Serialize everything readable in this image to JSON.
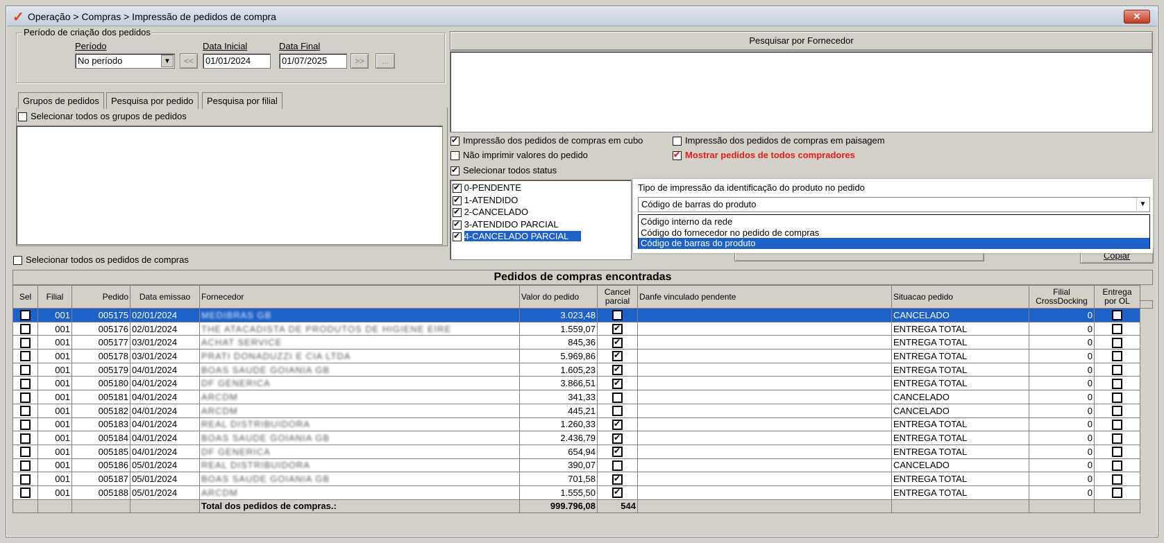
{
  "window": {
    "title": "Operação > Compras > Impressão de pedidos de compra",
    "close": "✕"
  },
  "periodo_group": {
    "legend": "Período de criação dos pedidos",
    "periodo_label": "Período",
    "periodo_value": "No período",
    "data_inicial_label": "Data Inicial",
    "data_inicial_value": "01/01/2024",
    "data_final_label": "Data Final",
    "data_final_value": "01/07/2025",
    "prev_btn": "<<",
    "next_btn": ">>",
    "more_btn": "..."
  },
  "tabs": [
    "Grupos de pedidos",
    "Pesquisa por pedido",
    "Pesquisa por filial"
  ],
  "select_all_groups": "Selecionar todos os grupos de pedidos",
  "select_all_orders": "Selecionar todos os pedidos de compras",
  "fornecedor_header": "Pesquisar por Fornecedor",
  "options": {
    "cubo": "Impressão dos pedidos de compras em cubo",
    "paisagem": "Impressão dos pedidos de compras em paisagem",
    "nao_imprimir": "Não imprimir valores do pedido",
    "mostrar_todos": "Mostrar pedidos de todos compradores",
    "selecionar_status": "Selecionar todos status"
  },
  "status_list": [
    "0-PENDENTE",
    "1-ATENDIDO",
    "2-CANCELADO",
    "3-ATENDIDO PARCIAL",
    "4-CANCELADO PARCIAL"
  ],
  "tipo_impressao": {
    "label": "Tipo de impressão da identificação do produto no pedido",
    "value": "Código de barras do produto",
    "options": [
      "Código interno da rede",
      "Código do fornecedor no pedido de compras",
      "Código de barras do produto"
    ]
  },
  "copiar_btn": "Copiar",
  "grid": {
    "title": "Pedidos de compras encontradas",
    "headers": {
      "sel": "Sel",
      "filial": "Filial",
      "pedido": "Pedido",
      "data": "Data emissao",
      "fornecedor": "Fornecedor",
      "valor": "Valor do pedido",
      "cancel": "Cancel parcial",
      "danfe": "Danfe vinculado pendente",
      "situacao": "Situacao pedido",
      "crossdock": "Filial CrossDocking",
      "entrega": "Entrega por OL"
    },
    "rows": [
      {
        "filial": "001",
        "pedido": "005175",
        "data": "02/01/2024",
        "fornecedor": "MEDIBRAS GB",
        "valor": "3.023,48",
        "cancel": false,
        "situacao": "CANCELADO",
        "cross": "0"
      },
      {
        "filial": "001",
        "pedido": "005176",
        "data": "02/01/2024",
        "fornecedor": "THE ATACADISTA DE PRODUTOS DE HIGIENE EIRE",
        "valor": "1.559,07",
        "cancel": true,
        "situacao": "ENTREGA TOTAL",
        "cross": "0"
      },
      {
        "filial": "001",
        "pedido": "005177",
        "data": "03/01/2024",
        "fornecedor": "ACHAT SERVICE",
        "valor": "845,36",
        "cancel": true,
        "situacao": "ENTREGA TOTAL",
        "cross": "0"
      },
      {
        "filial": "001",
        "pedido": "005178",
        "data": "03/01/2024",
        "fornecedor": "PRATI DONADUZZI E CIA LTDA",
        "valor": "5.969,86",
        "cancel": true,
        "situacao": "ENTREGA TOTAL",
        "cross": "0"
      },
      {
        "filial": "001",
        "pedido": "005179",
        "data": "04/01/2024",
        "fornecedor": "BOAS SAUDE GOIANIA GB",
        "valor": "1.605,23",
        "cancel": true,
        "situacao": "ENTREGA TOTAL",
        "cross": "0"
      },
      {
        "filial": "001",
        "pedido": "005180",
        "data": "04/01/2024",
        "fornecedor": "DF GENERICA",
        "valor": "3.866,51",
        "cancel": true,
        "situacao": "ENTREGA TOTAL",
        "cross": "0"
      },
      {
        "filial": "001",
        "pedido": "005181",
        "data": "04/01/2024",
        "fornecedor": "ARCDM",
        "valor": "341,33",
        "cancel": false,
        "situacao": "CANCELADO",
        "cross": "0"
      },
      {
        "filial": "001",
        "pedido": "005182",
        "data": "04/01/2024",
        "fornecedor": "ARCDM",
        "valor": "445,21",
        "cancel": false,
        "situacao": "CANCELADO",
        "cross": "0"
      },
      {
        "filial": "001",
        "pedido": "005183",
        "data": "04/01/2024",
        "fornecedor": "REAL DISTRIBUIDORA",
        "valor": "1.260,33",
        "cancel": true,
        "situacao": "ENTREGA TOTAL",
        "cross": "0"
      },
      {
        "filial": "001",
        "pedido": "005184",
        "data": "04/01/2024",
        "fornecedor": "BOAS SAUDE GOIANIA GB",
        "valor": "2.436,79",
        "cancel": true,
        "situacao": "ENTREGA TOTAL",
        "cross": "0"
      },
      {
        "filial": "001",
        "pedido": "005185",
        "data": "04/01/2024",
        "fornecedor": "DF GENERICA",
        "valor": "654,94",
        "cancel": true,
        "situacao": "ENTREGA TOTAL",
        "cross": "0"
      },
      {
        "filial": "001",
        "pedido": "005186",
        "data": "05/01/2024",
        "fornecedor": "REAL DISTRIBUIDORA",
        "valor": "390,07",
        "cancel": false,
        "situacao": "CANCELADO",
        "cross": "0"
      },
      {
        "filial": "001",
        "pedido": "005187",
        "data": "05/01/2024",
        "fornecedor": "BOAS SAUDE GOIANIA GB",
        "valor": "701,58",
        "cancel": true,
        "situacao": "ENTREGA TOTAL",
        "cross": "0"
      },
      {
        "filial": "001",
        "pedido": "005188",
        "data": "05/01/2024",
        "fornecedor": "ARCDM",
        "valor": "1.555,50",
        "cancel": true,
        "situacao": "ENTREGA TOTAL",
        "cross": "0"
      }
    ],
    "footer": {
      "label": "Total dos pedidos de compras.:",
      "total": "999.796,08",
      "count": "544"
    }
  },
  "colors": {
    "selection": "#1e62c8",
    "highlight_red": "#e0201a"
  }
}
